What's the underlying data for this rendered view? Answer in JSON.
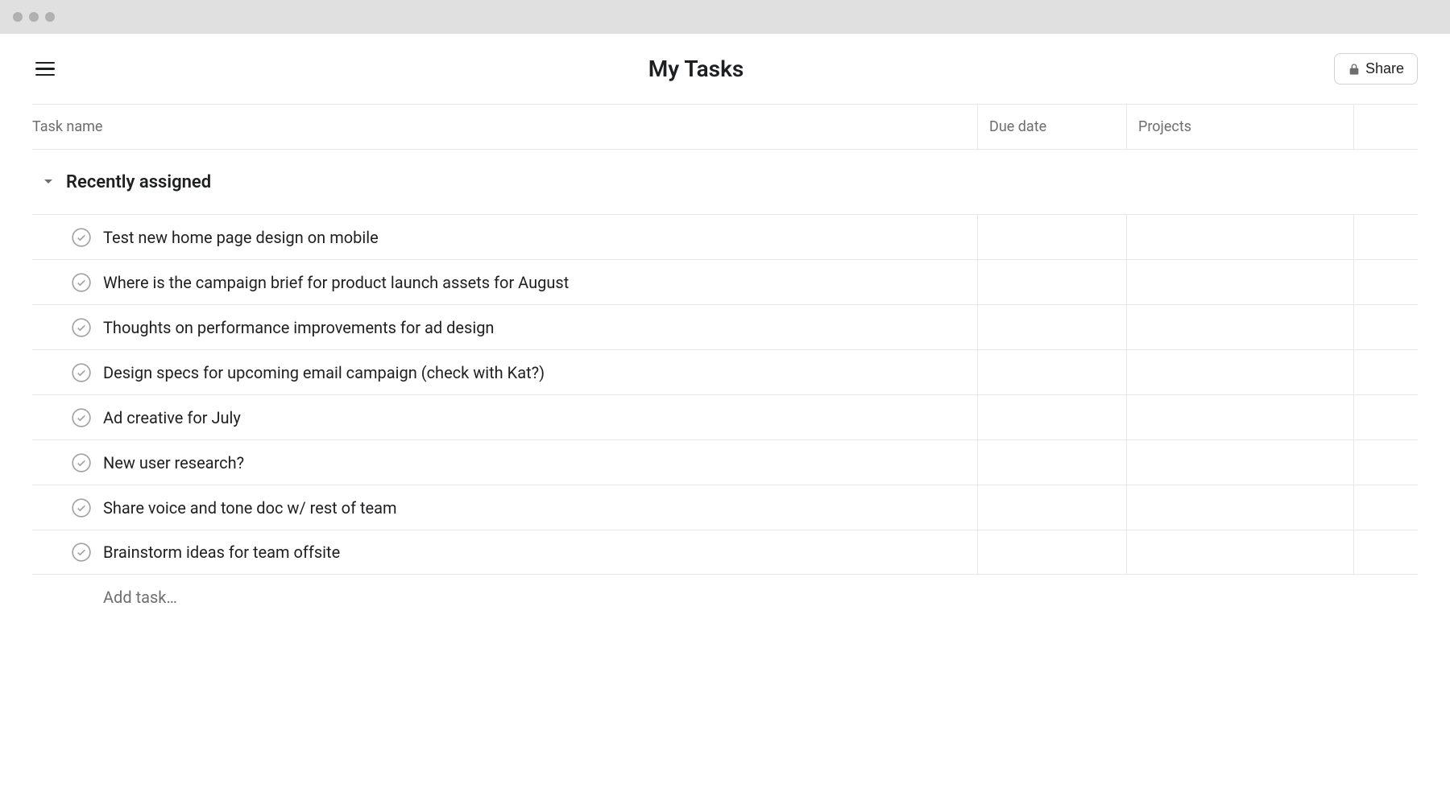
{
  "header": {
    "title": "My Tasks",
    "share_label": "Share"
  },
  "columns": {
    "task_name": "Task name",
    "due_date": "Due date",
    "projects": "Projects"
  },
  "section": {
    "title": "Recently assigned"
  },
  "tasks": [
    {
      "name": "Test new home page design on mobile"
    },
    {
      "name": "Where is the campaign brief for product launch assets for August"
    },
    {
      "name": "Thoughts on performance improvements for ad design"
    },
    {
      "name": "Design specs for upcoming email campaign (check with Kat?)"
    },
    {
      "name": "Ad creative for July"
    },
    {
      "name": "New user research?"
    },
    {
      "name": "Share voice and tone doc w/ rest of team"
    },
    {
      "name": "Brainstorm ideas for team offsite"
    }
  ],
  "add_task": {
    "label": "Add task…"
  }
}
